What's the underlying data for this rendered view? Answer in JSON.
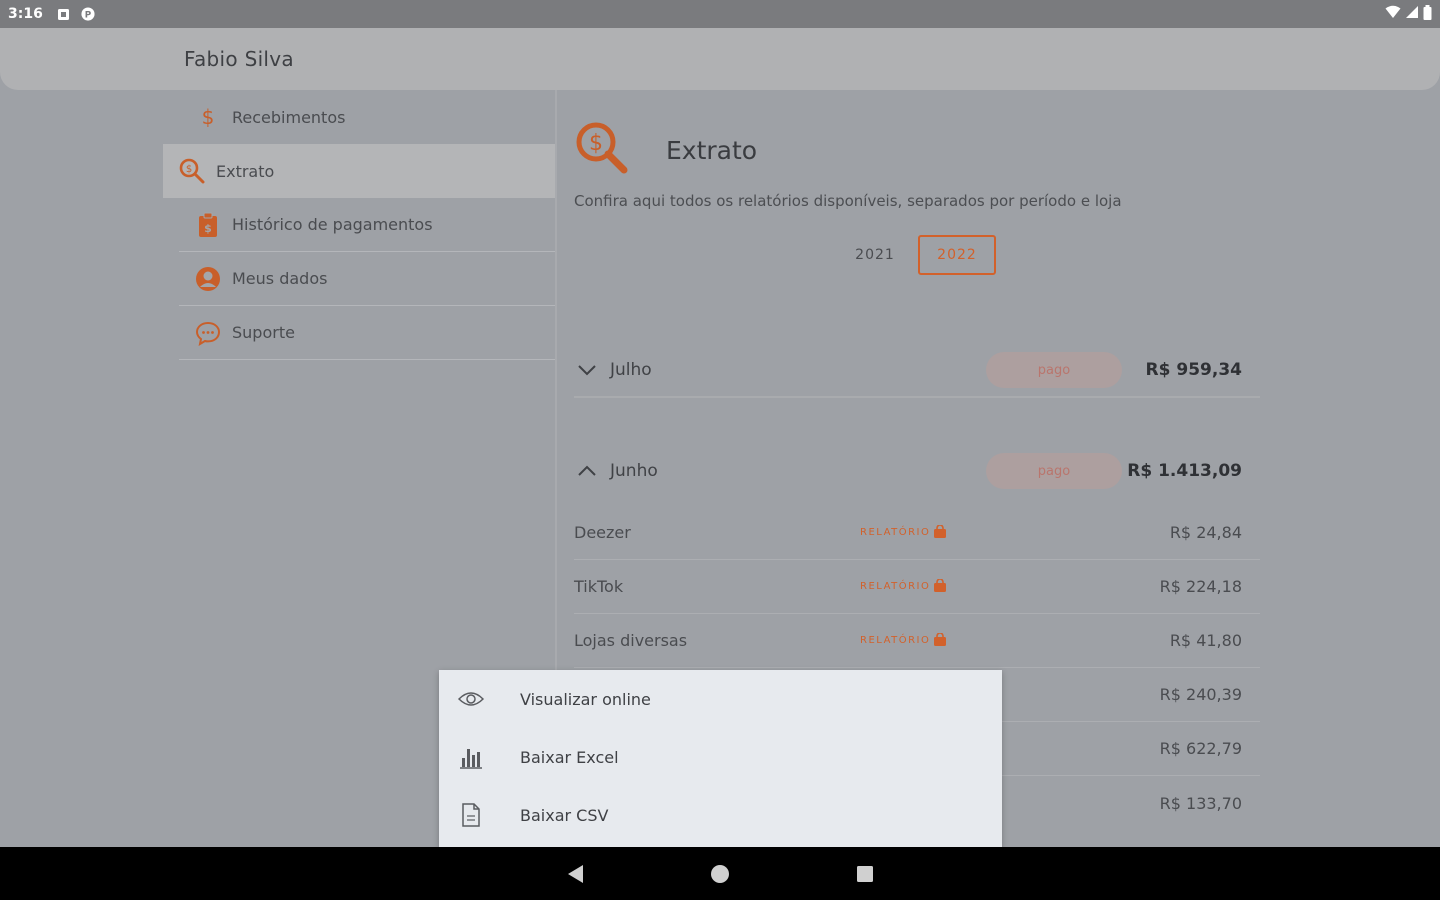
{
  "status_bar": {
    "time": "3:16"
  },
  "header": {
    "user_name": "Fabio Silva"
  },
  "sidebar": {
    "items": [
      {
        "label": "Recebimentos",
        "icon": "dollar-icon",
        "active": false
      },
      {
        "label": "Extrato",
        "icon": "search-dollar-icon",
        "active": true
      },
      {
        "label": "Histórico de pagamentos",
        "icon": "clipboard-icon",
        "active": false
      },
      {
        "label": "Meus dados",
        "icon": "user-icon",
        "active": false
      },
      {
        "label": "Suporte",
        "icon": "chat-icon",
        "active": false
      }
    ]
  },
  "main": {
    "title": "Extrato",
    "subtitle": "Confira aqui todos os relatórios disponíveis, separados por período e loja",
    "years": [
      "2021",
      "2022"
    ],
    "selected_year": "2022",
    "months": [
      {
        "name": "Julho",
        "status": "pago",
        "total": "R$ 959,34",
        "expanded": false
      },
      {
        "name": "Junho",
        "status": "pago",
        "total": "R$ 1.413,09",
        "expanded": true
      }
    ],
    "report_label": "RELATÓRIO",
    "stores": [
      {
        "name": "Deezer",
        "amount": "R$ 24,84"
      },
      {
        "name": "TikTok",
        "amount": "R$ 224,18"
      },
      {
        "name": "Lojas diversas",
        "amount": "R$ 41,80"
      },
      {
        "name": "",
        "amount": "R$ 240,39"
      },
      {
        "name": "",
        "amount": "R$ 622,79"
      },
      {
        "name": "",
        "amount": "R$ 133,70"
      }
    ]
  },
  "menu": {
    "items": [
      {
        "label": "Visualizar online",
        "icon": "eye-icon"
      },
      {
        "label": "Baixar Excel",
        "icon": "bar-chart-icon"
      },
      {
        "label": "Baixar CSV",
        "icon": "file-icon"
      }
    ]
  },
  "colors": {
    "accent": "#d2612b",
    "overlay": "#9ea1a6",
    "menu_bg": "#e7eaee"
  }
}
